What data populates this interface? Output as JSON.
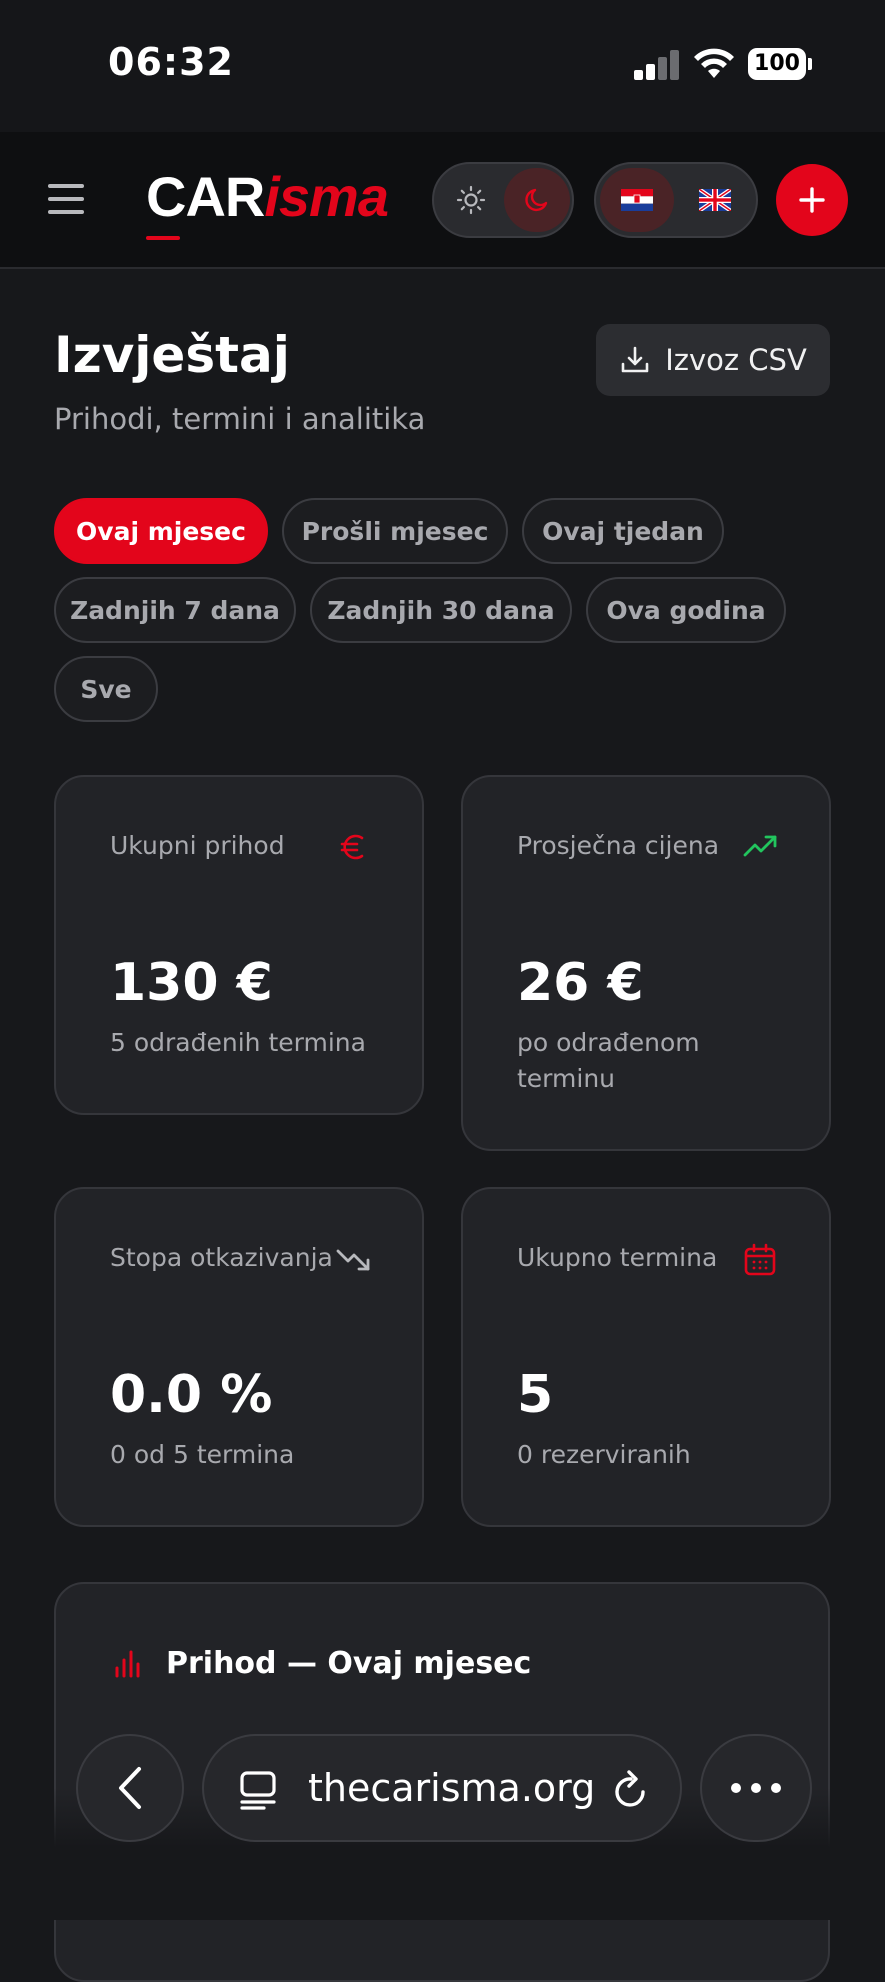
{
  "status_bar": {
    "time": "06:32",
    "battery": "100"
  },
  "header": {
    "logo_part1": "CAR",
    "logo_part2": "isma",
    "theme_options": [
      "sun-icon",
      "moon-icon"
    ],
    "active_theme": "dark",
    "languages": [
      "HR",
      "EN"
    ],
    "active_language": "HR",
    "accent_color": "#e3051b"
  },
  "page": {
    "title": "Izvještaj",
    "subtitle": "Prihodi, termini i analitika",
    "export_label": "Izvoz CSV"
  },
  "filters": [
    {
      "label": "Ovaj mjesec",
      "active": true
    },
    {
      "label": "Prošli mjesec",
      "active": false
    },
    {
      "label": "Ovaj tjedan",
      "active": false
    },
    {
      "label": "Zadnjih 7 dana",
      "active": false
    },
    {
      "label": "Zadnjih 30 dana",
      "active": false
    },
    {
      "label": "Ova godina",
      "active": false
    },
    {
      "label": "Sve",
      "active": false
    }
  ],
  "stats": [
    {
      "label": "Ukupni prihod",
      "value": "130 €",
      "note": "5 odrađenih termina",
      "icon": "euro-icon",
      "icon_color": "#e3051b"
    },
    {
      "label": "Prosječna cijena",
      "value": "26 €",
      "note": "po odrađenom terminu",
      "icon": "trending-up-icon",
      "icon_color": "#22c55e"
    },
    {
      "label": "Stopa otkazivanja",
      "value": "0.0 %",
      "note": "0 od 5 termina",
      "icon": "trending-down-icon",
      "icon_color": "#b8b9bd"
    },
    {
      "label": "Ukupno termina",
      "value": "5",
      "note": "0 rezerviranih",
      "icon": "calendar-icon",
      "icon_color": "#e3051b"
    }
  ],
  "revenue": {
    "title": "Prihod — Ovaj mjesec"
  },
  "browser": {
    "url": "thecarisma.org"
  }
}
